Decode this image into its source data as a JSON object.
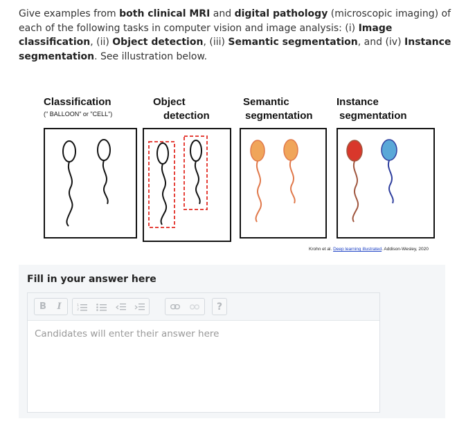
{
  "question": {
    "segments": [
      {
        "t": "Give examples from ",
        "b": false
      },
      {
        "t": "both clinical MRI",
        "b": true
      },
      {
        "t": " and ",
        "b": false
      },
      {
        "t": "digital pathology",
        "b": true
      },
      {
        "t": " (microscopic imaging) of each of the following tasks in computer vision and image analysis: (i) ",
        "b": false
      },
      {
        "t": "Image classification",
        "b": true
      },
      {
        "t": ", (ii) ",
        "b": false
      },
      {
        "t": "Object detection",
        "b": true
      },
      {
        "t": ", (iii) ",
        "b": false
      },
      {
        "t": "Semantic segmentation",
        "b": true
      },
      {
        "t": ", and (iv) ",
        "b": false
      },
      {
        "t": "Instance segmentation",
        "b": true
      },
      {
        "t": ". See illustration below.",
        "b": false
      }
    ]
  },
  "figure": {
    "columns": [
      {
        "line1": "Classification",
        "line2": "",
        "sub": "(\" BALLOON\" or \"CELL\")"
      },
      {
        "line1": "Object",
        "line2": "detection",
        "sub": ""
      },
      {
        "line1": "Semantic",
        "line2": "segmentation",
        "sub": ""
      },
      {
        "line1": "Instance",
        "line2": "segmentation",
        "sub": ""
      }
    ],
    "credit_prefix": "Krohn et al. ",
    "credit_link": "Deep learning illustrated",
    "credit_suffix": ". Addison-Wesley, 2020",
    "colors": {
      "semantic": "#f0a55a",
      "semantic_string": "#e0784a",
      "instance_1": "#d9372b",
      "instance_1_string": "#a0563e",
      "instance_2": "#5aa8d8",
      "instance_2_string": "#2f3f9e",
      "detection_box": "#e5413a"
    }
  },
  "answer": {
    "label": "Fill in your answer here",
    "placeholder": "Candidates will enter their answer here",
    "toolbar": {
      "bold": "B",
      "italic": "I",
      "help": "?"
    }
  }
}
